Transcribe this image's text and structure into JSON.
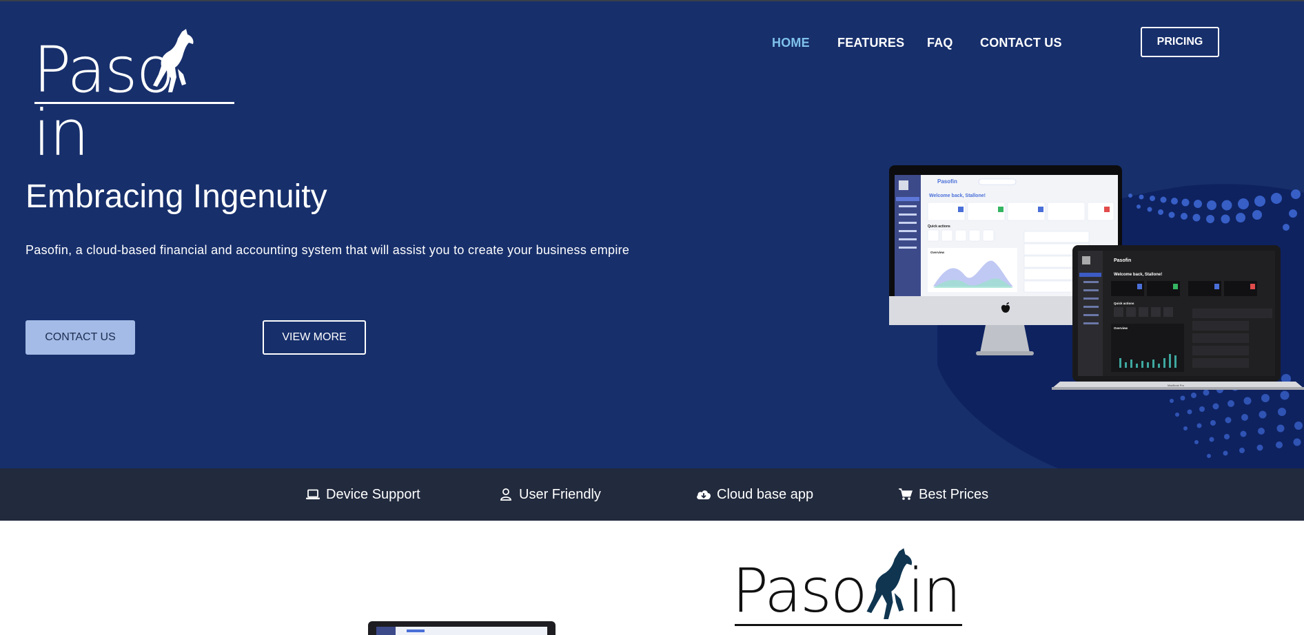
{
  "logo": {
    "part1": "Paso",
    "part2": "in"
  },
  "nav": {
    "items": [
      {
        "label": "HOME",
        "active": true
      },
      {
        "label": "FEATURES",
        "active": false
      },
      {
        "label": "FAQ",
        "active": false
      },
      {
        "label": "CONTACT US",
        "active": false
      }
    ],
    "pricing": "PRICING"
  },
  "hero": {
    "title": "Embracing Ingenuity",
    "subtitle": "Pasofin, a cloud-based financial and accounting system that will assist you to create your business empire",
    "contact_button": "CONTACT US",
    "view_more_button": "VIEW MORE"
  },
  "mockup": {
    "brand": "Pasofin",
    "welcome_light": "Welcome back, Stallone!",
    "welcome_dark": "Welcome back, Stallone!",
    "quick_actions": "Quick actions",
    "overview": "Overview",
    "laptop_label": "MacBook Pro"
  },
  "features": [
    {
      "icon": "laptop-icon",
      "label": "Device Support"
    },
    {
      "icon": "user-icon",
      "label": "User Friendly"
    },
    {
      "icon": "cloud-download-icon",
      "label": "Cloud base app"
    },
    {
      "icon": "cart-icon",
      "label": "Best Prices"
    }
  ],
  "lower": {
    "logo_part1": "Paso",
    "logo_part2": "in"
  },
  "colors": {
    "hero_bg": "#172f6b",
    "feature_bar": "#222a3d",
    "nav_active": "#7fc2ec",
    "contact_button_bg": "#a3bbe6"
  }
}
